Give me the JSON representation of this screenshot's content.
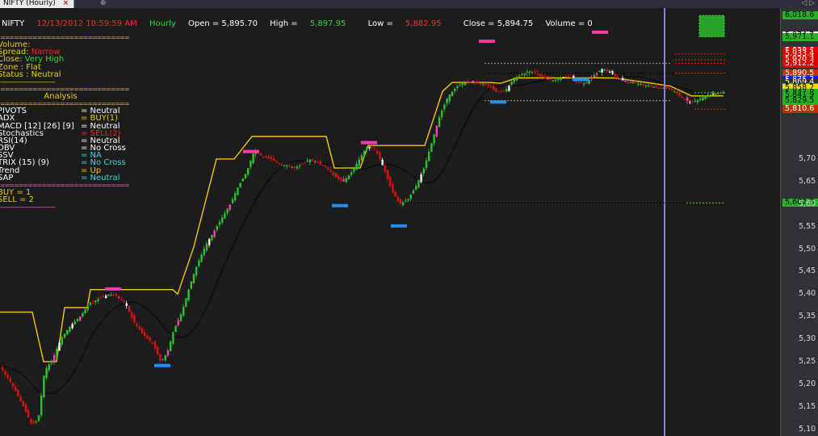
{
  "tab": {
    "title": "NIFTY (Hourly)",
    "close_glyph": "×",
    "new_glyph": "⊕",
    "right_glyph": "◁ ▷"
  },
  "header": {
    "symbol": "NIFTY",
    "datetime": "12/13/2012 10:59:59 AM",
    "interval": "Hourly",
    "open": "Open = 5,895.70",
    "high_label": "High = ",
    "high": "5,897.95",
    "low_label": "Low = ",
    "low": "5,882.95",
    "close": "Close = 5,894.75",
    "volume": "Volume = 0"
  },
  "info": {
    "top_sep": "====================================",
    "volume": "Volume:",
    "spread_label": "Spread: ",
    "spread": "Narrow",
    "close_label": "Close: ",
    "close": "Very High",
    "zone_label": "Zone : ",
    "zone": "Flat",
    "status_label": "Status : ",
    "status": "Neutral",
    "sep1": "------------------------------------",
    "sep2": "====================================",
    "analysis": "Analysis",
    "sep3": "====================================",
    "indicators": [
      {
        "name": "PIVOTS",
        "value": "= Neutral",
        "color": "#ffffff"
      },
      {
        "name": "ADX",
        "value": "= BUY(1)",
        "color": "#e6d000"
      },
      {
        "name": "MACD [12] [26] [9]",
        "value": "= Neutral",
        "color": "#ffffff"
      },
      {
        "name": "Stochastics",
        "value": "= SELL(2)",
        "color": "#ff2020"
      },
      {
        "name": "RSI(14)",
        "value": "= Neutral",
        "color": "#ffffff"
      },
      {
        "name": "OBV",
        "value": "= No Cross",
        "color": "#ffffff"
      },
      {
        "name": "SSV",
        "value": "= NA",
        "color": "#40d8d8"
      },
      {
        "name": "TRIX (15) (9)",
        "value": "= No Cross",
        "color": "#40d8d8"
      },
      {
        "name": "Trend",
        "value": "= Up",
        "color": "#e6d000"
      },
      {
        "name": "SAP",
        "value": "= Neutral",
        "color": "#40d8d8"
      }
    ],
    "sep4": "====================================",
    "buy": "BUY  =   1",
    "sell": "SELL  =   2",
    "sep5": "------------------------------------"
  },
  "price_tags": [
    {
      "text": "6,018.6",
      "bg": "#22b522",
      "fg": "#000000",
      "price": 6018.6
    },
    {
      "text": "5,974.7",
      "bg": "#ffffff",
      "fg": "#000000",
      "price": 5974.7
    },
    {
      "text": "5,971.1",
      "bg": "#22b522",
      "fg": "#000000",
      "price": 5971.1
    },
    {
      "text": "5,939.8",
      "bg": "#e00000",
      "fg": "#ffffff",
      "price": 5939.8
    },
    {
      "text": "5,938.6",
      "bg": "#e00000",
      "fg": "#ffffff",
      "price": 5938.6
    },
    {
      "text": "5,933.4",
      "bg": "#e00000",
      "fg": "#ffffff",
      "price": 5933.4
    },
    {
      "text": "5,920.3",
      "bg": "#e00000",
      "fg": "#ffffff",
      "price": 5920.3
    },
    {
      "text": "5,912.2",
      "bg": "#e00000",
      "fg": "#ffffff",
      "price": 5912.2
    },
    {
      "text": "5,890.5",
      "bg": "#bb3300",
      "fg": "#ffffff",
      "price": 5890.5
    },
    {
      "text": "5,875.2",
      "bg": "#1010ff",
      "fg": "#ffffff",
      "price": 5875.2
    },
    {
      "text": "5,869.4",
      "bg": "#2e2e2e",
      "fg": "#ffffff",
      "price": 5869.4
    },
    {
      "text": "5,860.2",
      "bg": "#22b522",
      "fg": "#000000",
      "price": 5860.2
    },
    {
      "text": "5,858.2",
      "bg": "#f0e000",
      "fg": "#000000",
      "price": 5858.2
    },
    {
      "text": "5,847.0",
      "bg": "#22b522",
      "fg": "#000000",
      "price": 5847.0
    },
    {
      "text": "5,841.9",
      "bg": "#22b522",
      "fg": "#000000",
      "price": 5841.9
    },
    {
      "text": "5,829.5",
      "bg": "#22b522",
      "fg": "#000000",
      "price": 5829.5
    },
    {
      "text": "5,810.6",
      "bg": "#bb3300",
      "fg": "#ffffff",
      "price": 5810.6
    },
    {
      "text": "5,602.3",
      "bg": "#22b522",
      "fg": "#000000",
      "price": 5602.3
    }
  ],
  "colors": {
    "bull": "#2fc02f",
    "bear": "#e01010",
    "neutral": "#f2f2f2",
    "magenta": "#ff40c0",
    "sar": "#f2c800",
    "ma": "#222222",
    "marker_top": "#ff3aa8",
    "marker_bottom": "#1e90ff",
    "cursor": "#8080ff"
  },
  "chart_data": {
    "type": "candlestick",
    "symbol": "NIFTY",
    "interval": "Hourly",
    "ylim": [
      5085,
      6035
    ],
    "y_ticks": [
      5100,
      5150,
      5200,
      5250,
      5300,
      5350,
      5400,
      5450,
      5500,
      5550,
      5600,
      5650,
      5700
    ],
    "y_tick_labels": [
      "5,10",
      "5,15",
      "5,20",
      "5,25",
      "5,30",
      "5,35",
      "5,40",
      "5,45",
      "5,50",
      "5,55",
      "5,60",
      "5,65",
      "5,70"
    ],
    "close_path": [
      [
        0,
        5240
      ],
      [
        10,
        5215
      ],
      [
        20,
        5185
      ],
      [
        30,
        5150
      ],
      [
        40,
        5110
      ],
      [
        48,
        5120
      ],
      [
        56,
        5230
      ],
      [
        66,
        5255
      ],
      [
        76,
        5300
      ],
      [
        88,
        5330
      ],
      [
        100,
        5350
      ],
      [
        112,
        5380
      ],
      [
        124,
        5390
      ],
      [
        136,
        5400
      ],
      [
        146,
        5395
      ],
      [
        156,
        5380
      ],
      [
        166,
        5340
      ],
      [
        178,
        5310
      ],
      [
        190,
        5290
      ],
      [
        200,
        5250
      ],
      [
        208,
        5270
      ],
      [
        216,
        5320
      ],
      [
        226,
        5360
      ],
      [
        236,
        5420
      ],
      [
        246,
        5470
      ],
      [
        256,
        5510
      ],
      [
        266,
        5540
      ],
      [
        276,
        5570
      ],
      [
        286,
        5600
      ],
      [
        296,
        5640
      ],
      [
        306,
        5670
      ],
      [
        316,
        5720
      ],
      [
        326,
        5705
      ],
      [
        336,
        5700
      ],
      [
        346,
        5690
      ],
      [
        356,
        5685
      ],
      [
        366,
        5680
      ],
      [
        376,
        5690
      ],
      [
        386,
        5700
      ],
      [
        396,
        5690
      ],
      [
        406,
        5680
      ],
      [
        416,
        5660
      ],
      [
        426,
        5650
      ],
      [
        436,
        5670
      ],
      [
        446,
        5700
      ],
      [
        456,
        5730
      ],
      [
        466,
        5720
      ],
      [
        476,
        5680
      ],
      [
        486,
        5630
      ],
      [
        496,
        5600
      ],
      [
        506,
        5610
      ],
      [
        516,
        5640
      ],
      [
        526,
        5680
      ],
      [
        536,
        5740
      ],
      [
        546,
        5800
      ],
      [
        556,
        5840
      ],
      [
        566,
        5860
      ],
      [
        576,
        5870
      ],
      [
        586,
        5870
      ],
      [
        596,
        5868
      ],
      [
        606,
        5862
      ],
      [
        616,
        5848
      ],
      [
        626,
        5850
      ],
      [
        636,
        5875
      ],
      [
        646,
        5888
      ],
      [
        656,
        5895
      ],
      [
        666,
        5888
      ],
      [
        676,
        5878
      ],
      [
        686,
        5874
      ],
      [
        696,
        5880
      ],
      [
        706,
        5884
      ],
      [
        716,
        5870
      ],
      [
        726,
        5868
      ],
      [
        736,
        5885
      ],
      [
        746,
        5900
      ],
      [
        756,
        5893
      ],
      [
        766,
        5878
      ],
      [
        776,
        5872
      ],
      [
        786,
        5870
      ],
      [
        796,
        5865
      ],
      [
        806,
        5862
      ],
      [
        816,
        5858
      ],
      [
        826,
        5858
      ],
      [
        836,
        5850
      ],
      [
        846,
        5835
      ],
      [
        856,
        5825
      ],
      [
        866,
        5832
      ],
      [
        876,
        5842
      ],
      [
        886,
        5845
      ],
      [
        896,
        5847
      ]
    ],
    "sar_levels_chart": "stepped trailing stop line (yellow)",
    "annotations": [
      "cursor vertical line",
      "resistance dotted lines",
      "support dotted line at 5,602.3"
    ]
  }
}
